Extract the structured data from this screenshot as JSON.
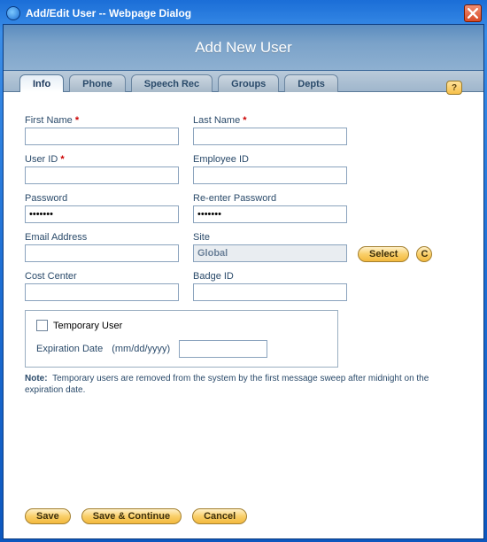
{
  "window": {
    "title": "Add/Edit User -- Webpage Dialog"
  },
  "header": {
    "title": "Add New User"
  },
  "tabs": [
    {
      "label": "Info",
      "active": true
    },
    {
      "label": "Phone",
      "active": false
    },
    {
      "label": "Speech Rec",
      "active": false
    },
    {
      "label": "Groups",
      "active": false
    },
    {
      "label": "Depts",
      "active": false
    }
  ],
  "help": {
    "label": "?"
  },
  "fields": {
    "first_name": {
      "label": "First Name",
      "required": true,
      "value": ""
    },
    "last_name": {
      "label": "Last Name",
      "required": true,
      "value": ""
    },
    "user_id": {
      "label": "User ID",
      "required": true,
      "value": ""
    },
    "employee_id": {
      "label": "Employee ID",
      "value": ""
    },
    "password": {
      "label": "Password",
      "value": "•••••••"
    },
    "reenter_password": {
      "label": "Re-enter Password",
      "value": "•••••••"
    },
    "email": {
      "label": "Email Address",
      "value": ""
    },
    "site": {
      "label": "Site",
      "value": "Global"
    },
    "cost_center": {
      "label": "Cost Center",
      "value": ""
    },
    "badge_id": {
      "label": "Badge ID",
      "value": ""
    }
  },
  "buttons": {
    "select": "Select",
    "clear": "C",
    "save": "Save",
    "save_continue": "Save & Continue",
    "cancel": "Cancel"
  },
  "temp_user": {
    "checkbox_label": "Temporary User",
    "expiration_label": "Expiration Date",
    "expiration_hint": "(mm/dd/yyyy)",
    "value": ""
  },
  "note": {
    "bold": "Note:",
    "text": "Temporary users are removed from the system by the first message sweep after midnight on the expiration date."
  }
}
